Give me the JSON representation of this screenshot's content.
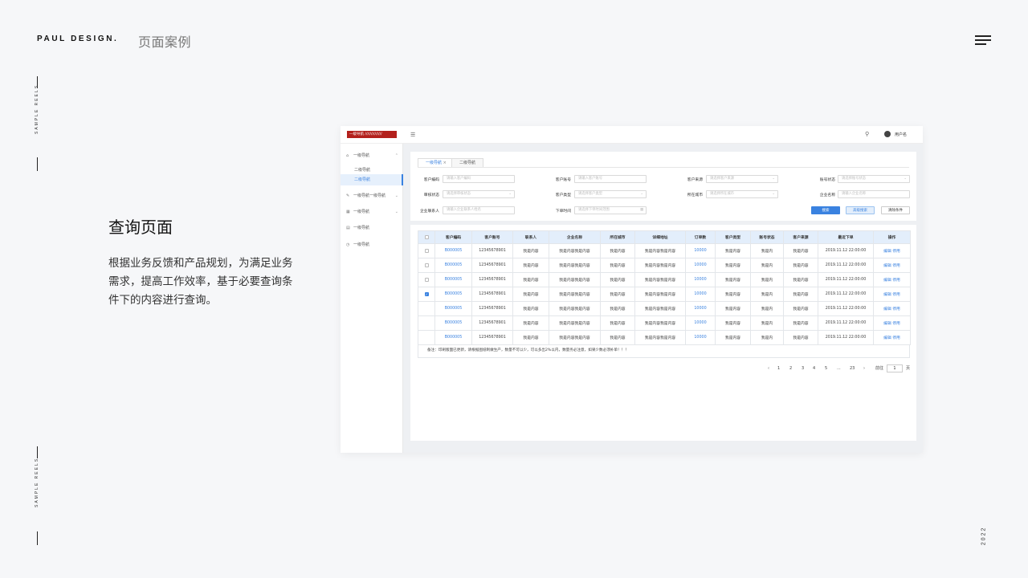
{
  "brand": "PAUL DESIGN.",
  "section_title": "页面案例",
  "side_text_top": "SAMPLE  REELS",
  "side_text_bottom": "SAMPLE  REELS",
  "year": "2022",
  "page_title": "查询页面",
  "description": "根据业务反馈和产品规划，为满足业务需求，提高工作效率，基于必要查询条件下的内容进行查询。",
  "app": {
    "logo_text": "一级导航 //////////////",
    "user_name": "用户名",
    "sidebar": [
      {
        "label": "一级导航",
        "icon": "home-icon",
        "chevron": "up"
      },
      {
        "label": "二级导航",
        "sub": true
      },
      {
        "label": "二级导航",
        "sub": true,
        "active": true
      },
      {
        "label": "一级导航一级导航",
        "icon": "edit-icon",
        "chevron": "down"
      },
      {
        "label": "一级导航",
        "icon": "calendar-icon",
        "chevron": "down"
      },
      {
        "label": "一级导航",
        "icon": "document-icon"
      },
      {
        "label": "一级导航",
        "icon": "clock-icon"
      }
    ],
    "tabs": [
      {
        "label": "一级导航",
        "active": true,
        "closable": true
      },
      {
        "label": "二级导航"
      }
    ],
    "filters": [
      {
        "label": "客户编码",
        "placeholder": "请输入客户编码"
      },
      {
        "label": "客户账号",
        "placeholder": "请输入客户账号"
      },
      {
        "label": "客户来源",
        "placeholder": "请选择客户来源",
        "select": true
      },
      {
        "label": "账号状态",
        "placeholder": "请选择账号状态",
        "select": true
      },
      {
        "label": "审核状态",
        "placeholder": "请选择审核状态",
        "select": true
      },
      {
        "label": "客户类型",
        "placeholder": "请选择客户类型",
        "select": true
      },
      {
        "label": "所在城市",
        "placeholder": "请选择所在城市",
        "select": true
      },
      {
        "label": "企业名称",
        "placeholder": "请输入企业名称"
      },
      {
        "label": "企业联系人",
        "placeholder": "请输入企业联系人姓名"
      },
      {
        "label": "下单时间",
        "placeholder": "请选择下单时间范围",
        "date": true
      }
    ],
    "buttons": {
      "search": "搜索",
      "advanced": "高级搜索",
      "clear": "清除条件"
    },
    "table": {
      "headers": [
        "",
        "客户编码",
        "客户账号",
        "联系人",
        "企业名称",
        "所在城市",
        "详细地址",
        "订单数",
        "客户类型",
        "账号状态",
        "客户来源",
        "最近下单",
        "操作"
      ],
      "rows": [
        {
          "checked": false,
          "code": "B000005",
          "account": "12345678901",
          "contact": "我是内容",
          "company": "我是内容我是内容",
          "city": "我是内容",
          "address": "我是内容我是内容",
          "orders": "10000",
          "type": "我是内容",
          "status": "我是内",
          "source": "我是内容",
          "last": "2019.11.12 22:00:00",
          "actions": "编辑 停用"
        },
        {
          "checked": false,
          "code": "B000005",
          "account": "12345678901",
          "contact": "我是内容",
          "company": "我是内容我是内容",
          "city": "我是内容",
          "address": "我是内容我是内容",
          "orders": "10000",
          "type": "我是内容",
          "status": "我是内",
          "source": "我是内容",
          "last": "2019.11.12 22:00:00",
          "actions": "编辑 停用"
        },
        {
          "checked": false,
          "code": "B000005",
          "account": "12345678901",
          "contact": "我是内容",
          "company": "我是内容我是内容",
          "city": "我是内容",
          "address": "我是内容我是内容",
          "orders": "10000",
          "type": "我是内容",
          "status": "我是内",
          "source": "我是内容",
          "last": "2019.11.12 22:00:00",
          "actions": "编辑 停用"
        },
        {
          "checked": true,
          "code": "B000005",
          "account": "12345678901",
          "contact": "我是内容",
          "company": "我是内容我是内容",
          "city": "我是内容",
          "address": "我是内容我是内容",
          "orders": "10000",
          "type": "我是内容",
          "status": "我是内",
          "source": "我是内容",
          "last": "2019.11.12 22:00:00",
          "actions": "编辑 停用"
        },
        {
          "checked": null,
          "code": "B000005",
          "account": "12345678901",
          "contact": "我是内容",
          "company": "我是内容我是内容",
          "city": "我是内容",
          "address": "我是内容我是内容",
          "orders": "10000",
          "type": "我是内容",
          "status": "我是内",
          "source": "我是内容",
          "last": "2019.11.12 22:00:00",
          "actions": "编辑 停用"
        },
        {
          "checked": null,
          "code": "B000005",
          "account": "12345678901",
          "contact": "我是内容",
          "company": "我是内容我是内容",
          "city": "我是内容",
          "address": "我是内容我是内容",
          "orders": "10000",
          "type": "我是内容",
          "status": "我是内",
          "source": "我是内容",
          "last": "2019.11.12 22:00:00",
          "actions": "编辑 停用"
        },
        {
          "checked": null,
          "code": "B000005",
          "account": "12345678901",
          "contact": "我是内容",
          "company": "我是内容我是内容",
          "city": "我是内容",
          "address": "我是内容我是内容",
          "orders": "10000",
          "type": "我是内容",
          "status": "我是内",
          "source": "我是内容",
          "last": "2019.11.12 22:00:00",
          "actions": "编辑 停用"
        }
      ],
      "note": "备注：印刷版面已更新，请根据图纸制做生产，数量不可以少，可以多出2%以内，数量务必注意，如果少数必须补单！！！"
    },
    "pagination": {
      "prev": "‹",
      "pages": [
        "1",
        "2",
        "3",
        "4",
        "5",
        "...",
        "23"
      ],
      "next": "›",
      "goto_label": "前往",
      "goto_value": "1",
      "page_unit": "页"
    },
    "colors": {
      "accent": "#3a82e0",
      "logo": "#b3201c",
      "header_bg": "#e3eefb"
    }
  }
}
